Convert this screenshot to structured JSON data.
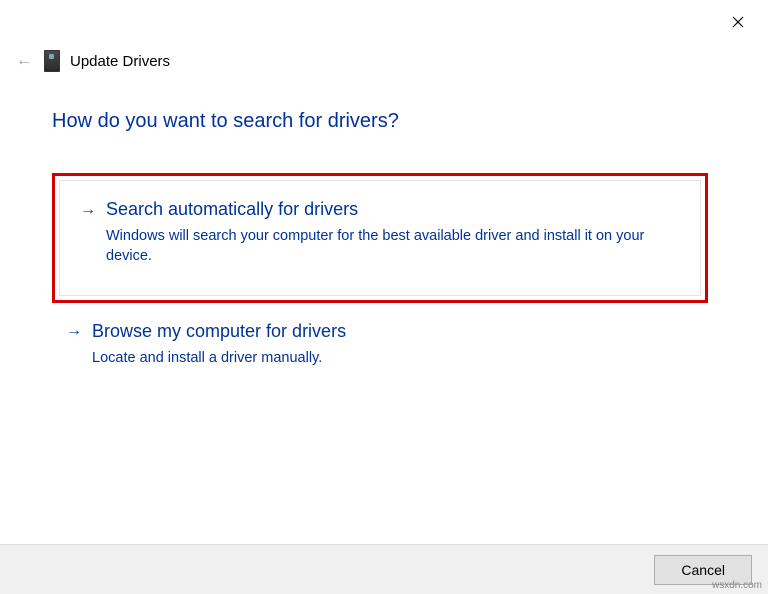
{
  "window": {
    "title": "Update Drivers"
  },
  "heading": "How do you want to search for drivers?",
  "options": {
    "auto": {
      "title": "Search automatically for drivers",
      "desc": "Windows will search your computer for the best available driver and install it on your device."
    },
    "browse": {
      "title": "Browse my computer for drivers",
      "desc": "Locate and install a driver manually."
    }
  },
  "footer": {
    "cancel": "Cancel"
  },
  "watermark": "wsxdn.com"
}
